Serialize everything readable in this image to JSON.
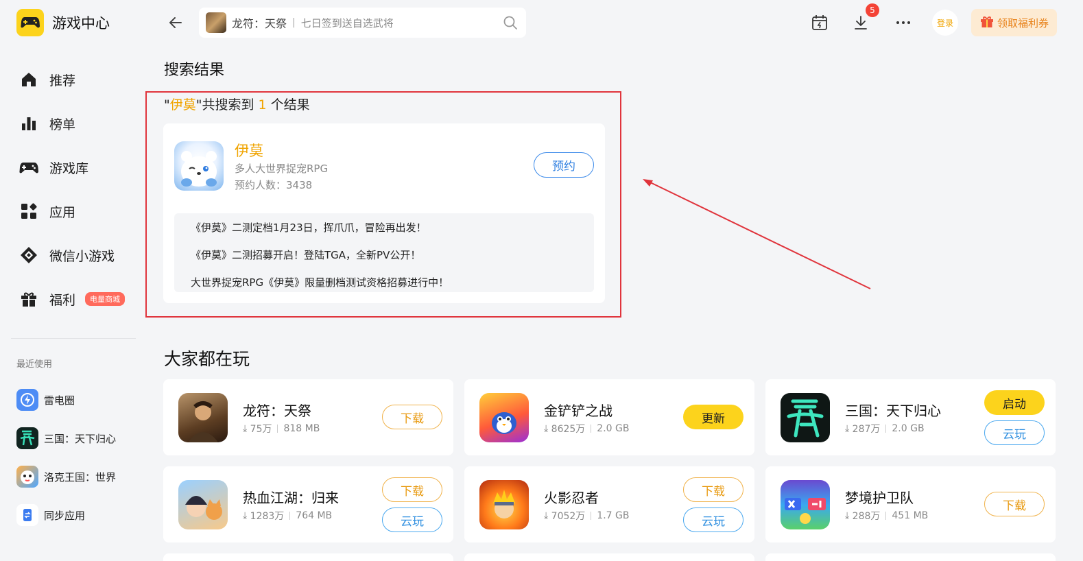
{
  "app": {
    "title": "游戏中心",
    "logo_icon": "gamepad-icon"
  },
  "sidebar": {
    "items": [
      {
        "label": "推荐",
        "icon": "home-icon"
      },
      {
        "label": "榜单",
        "icon": "ranking-icon"
      },
      {
        "label": "游戏库",
        "icon": "gamepad-icon"
      },
      {
        "label": "应用",
        "icon": "apps-icon"
      },
      {
        "label": "微信小游戏",
        "icon": "diamond-icon"
      },
      {
        "label": "福利",
        "icon": "gift-icon",
        "badge": "电量商城"
      }
    ],
    "recent_title": "最近使用",
    "recent": [
      {
        "label": "雷电圈"
      },
      {
        "label": "三国：天下归心"
      },
      {
        "label": "洛克王国：世界"
      },
      {
        "label": "同步应用"
      }
    ]
  },
  "topbar": {
    "search_game": "龙符：天祭",
    "search_separator": "|",
    "search_hint": "七日签到送自选武将",
    "download_badge": "5",
    "login_label": "登录",
    "coupon_label": "领取福利券"
  },
  "search_result": {
    "section_title": "搜索结果",
    "summary_open_quote": "\"",
    "summary_keyword": "伊莫",
    "summary_mid": "\"共搜索到 ",
    "summary_count": "1",
    "summary_tail": " 个结果",
    "card": {
      "name": "伊莫",
      "genre": "多人大世界捉宠RPG",
      "reserve_text": "预约人数：3438",
      "action_label": "预约",
      "news": [
        "《伊莫》二测定档1月23日，挥爪爪，冒险再出发！",
        "《伊莫》二测招募开启！登陆TGA，全新PV公开！",
        "大世界捉宠RPG《伊莫》限量删档测试资格招募进行中！"
      ]
    },
    "highlight_color": "#e0343c"
  },
  "popular": {
    "title": "大家都在玩",
    "games": [
      {
        "name": "龙符：天祭",
        "downloads": "75万",
        "size": "818 MB",
        "buttons": [
          "下载"
        ]
      },
      {
        "name": "金铲铲之战",
        "downloads": "8625万",
        "size": "2.0 GB",
        "buttons": [
          "更新"
        ]
      },
      {
        "name": "三国：天下归心",
        "downloads": "287万",
        "size": "2.0 GB",
        "buttons": [
          "启动",
          "云玩"
        ]
      },
      {
        "name": "热血江湖：归来",
        "downloads": "1283万",
        "size": "764 MB",
        "buttons": [
          "下载",
          "云玩"
        ]
      },
      {
        "name": "火影忍者",
        "downloads": "7052万",
        "size": "1.7 GB",
        "buttons": [
          "下载",
          "云玩"
        ]
      },
      {
        "name": "梦境护卫队",
        "downloads": "288万",
        "size": "451 MB",
        "buttons": [
          "下载"
        ]
      }
    ]
  },
  "colors": {
    "accent": "#fcd31c",
    "orange": "#f0a400",
    "blue": "#2f7fe0",
    "red": "#e0343c"
  }
}
